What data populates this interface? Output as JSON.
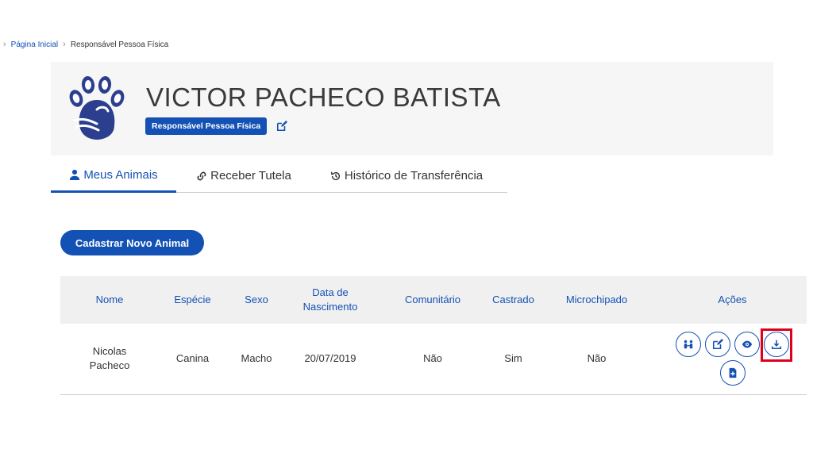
{
  "breadcrumb": {
    "home": "Página Inicial",
    "current": "Responsável Pessoa Física"
  },
  "header": {
    "name": "VICTOR PACHECO BATISTA",
    "role": "Responsável Pessoa Física"
  },
  "tabs": [
    {
      "label": "Meus Animais",
      "icon": "user-icon",
      "active": true
    },
    {
      "label": "Receber Tutela",
      "icon": "link-icon",
      "active": false
    },
    {
      "label": "Histórico de Transferência",
      "icon": "history-icon",
      "active": false
    }
  ],
  "main": {
    "new_animal_button": "Cadastrar Novo Animal"
  },
  "table": {
    "headers": {
      "nome": "Nome",
      "especie": "Espécie",
      "sexo": "Sexo",
      "nascimento_1": "Data de",
      "nascimento_2": "Nascimento",
      "comunitario": "Comunitário",
      "castrado": "Castrado",
      "microchipado": "Microchipado",
      "acoes": "Ações"
    },
    "rows": [
      {
        "nome_1": "Nicolas",
        "nome_2": "Pacheco",
        "especie": "Canina",
        "sexo": "Macho",
        "nascimento": "20/07/2019",
        "comunitario": "Não",
        "castrado": "Sim",
        "microchipado": "Não"
      }
    ]
  },
  "colors": {
    "primary": "#1351b4",
    "highlight": "#e0001b"
  }
}
